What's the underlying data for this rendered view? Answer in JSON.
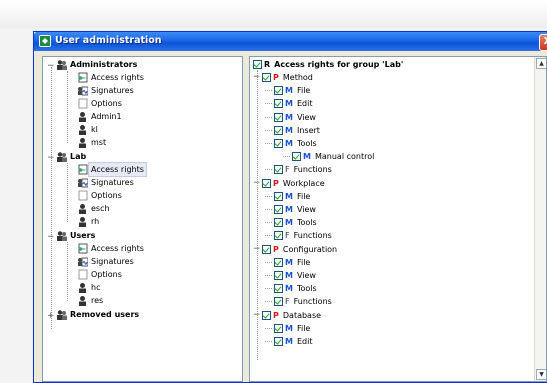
{
  "window": {
    "title": "User administration",
    "close_symbol": "X"
  },
  "left_tree": {
    "groups": [
      {
        "label": "Administrators",
        "items": [
          "Access rights",
          "Signatures",
          "Options",
          "Admin1",
          "kl",
          "mst"
        ]
      },
      {
        "label": "Lab",
        "items": [
          "Access rights",
          "Signatures",
          "Options",
          "esch",
          "rh"
        ]
      },
      {
        "label": "Users",
        "items": [
          "Access rights",
          "Signatures",
          "Options",
          "hc",
          "res"
        ]
      },
      {
        "label": "Removed users",
        "items": []
      }
    ]
  },
  "right_tree": {
    "root": {
      "tag": "R",
      "label": "Access rights for group 'Lab'"
    },
    "rows": [
      {
        "tag": "P",
        "label": "Method"
      },
      {
        "tag": "M",
        "label": "File"
      },
      {
        "tag": "M",
        "label": "Edit"
      },
      {
        "tag": "M",
        "label": "View"
      },
      {
        "tag": "M",
        "label": "Insert"
      },
      {
        "tag": "M",
        "label": "Tools"
      },
      {
        "tag": "M",
        "label": "Manual control"
      },
      {
        "tag": "F",
        "label": "Functions"
      },
      {
        "tag": "P",
        "label": "Workplace"
      },
      {
        "tag": "M",
        "label": "File"
      },
      {
        "tag": "M",
        "label": "View"
      },
      {
        "tag": "M",
        "label": "Tools"
      },
      {
        "tag": "F",
        "label": "Functions"
      },
      {
        "tag": "P",
        "label": "Configuration"
      },
      {
        "tag": "M",
        "label": "File"
      },
      {
        "tag": "M",
        "label": "View"
      },
      {
        "tag": "M",
        "label": "Tools"
      },
      {
        "tag": "F",
        "label": "Functions"
      },
      {
        "tag": "P",
        "label": "Database"
      },
      {
        "tag": "M",
        "label": "File"
      },
      {
        "tag": "M",
        "label": "Edit"
      }
    ]
  },
  "selected": {
    "group": "Lab",
    "item": "Access rights"
  }
}
